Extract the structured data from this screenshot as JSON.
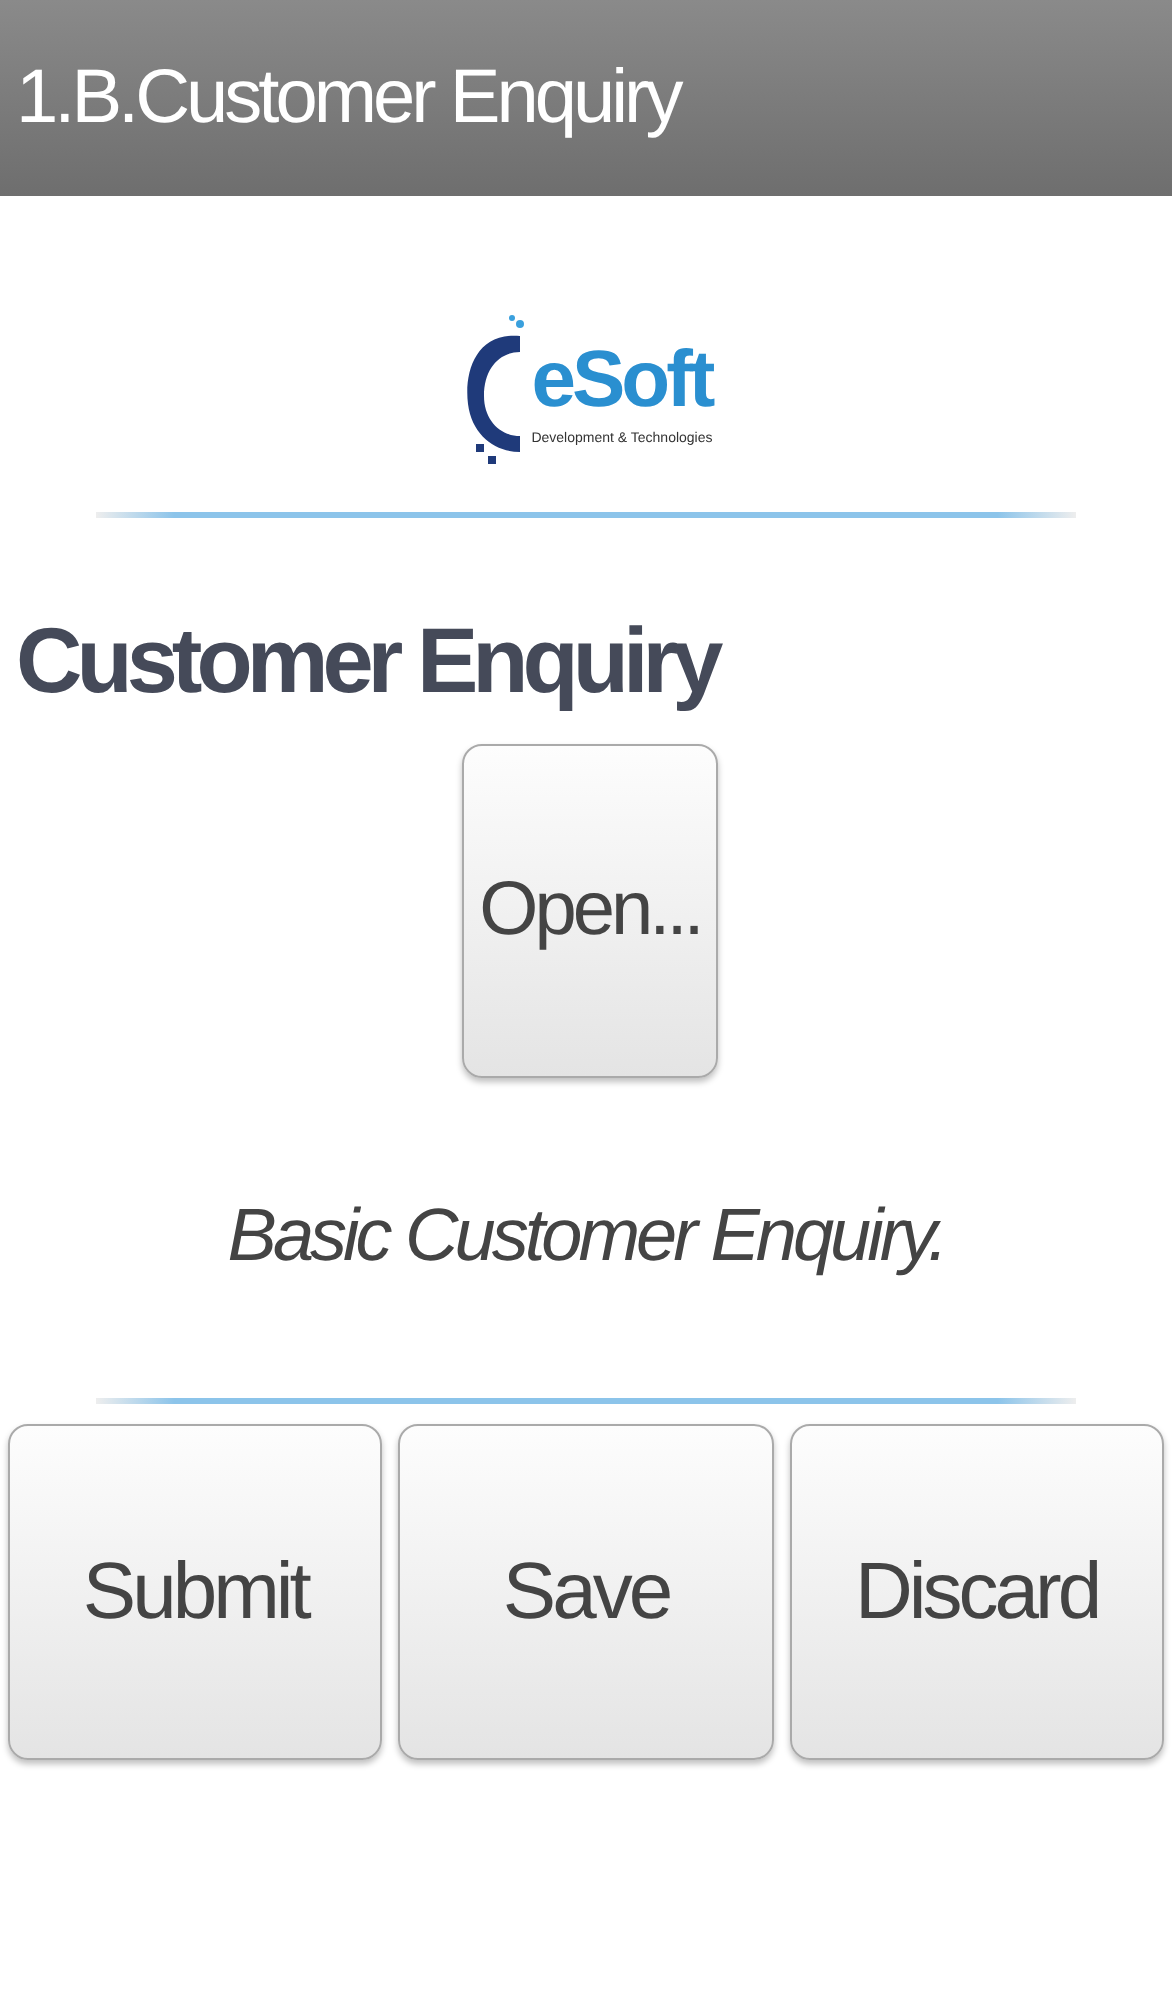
{
  "title_bar": {
    "title": "1.B.Customer Enquiry"
  },
  "logo": {
    "name": "eSoft",
    "tagline": "Development & Technologies"
  },
  "heading": "Customer Enquiry",
  "open_button": {
    "label": "Open..."
  },
  "description": "Basic Customer Enquiry.",
  "actions": [
    {
      "label": "Submit"
    },
    {
      "label": "Save"
    },
    {
      "label": "Discard"
    }
  ]
}
